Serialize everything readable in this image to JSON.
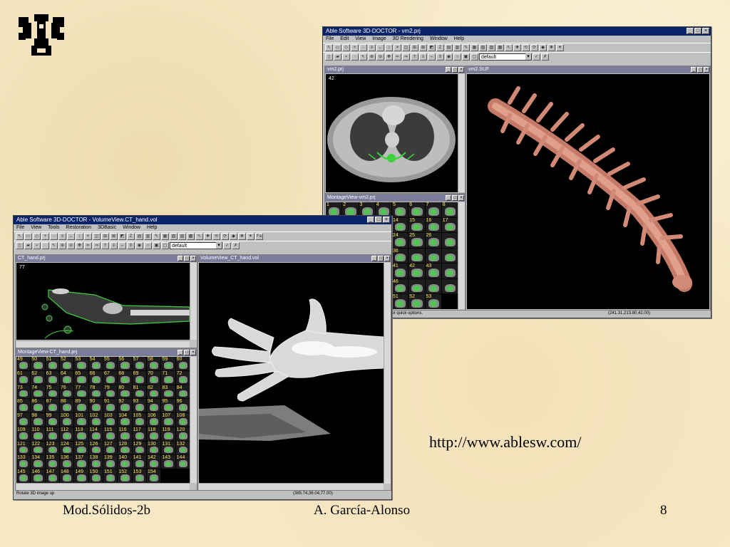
{
  "slide": {
    "url": "http://www.ablesw.com/",
    "footer_left": "Mod.Sólidos-2b",
    "footer_center": "A. García-Alonso",
    "page_number": "8"
  },
  "window_back": {
    "title": "Able Software 3D-DOCTOR - vm2.prj",
    "menu": [
      "File",
      "Edit",
      "View",
      "Image",
      "3D Rendering",
      "Window",
      "Help"
    ],
    "combo_value": "default",
    "child_slice": {
      "title": "vm2.prj",
      "slice_number": "42"
    },
    "child_montage": {
      "title": "MontageView-vm2.prj",
      "numbers": [
        "1",
        "2",
        "3",
        "4",
        "5",
        "6",
        "7",
        "8",
        "",
        "",
        "",
        "",
        "14",
        "15",
        "16",
        "17",
        "",
        "",
        "",
        "",
        "24",
        "25",
        "26",
        "",
        "",
        "",
        "",
        "",
        "36",
        "",
        "",
        "",
        "",
        "",
        "",
        "",
        "41",
        "42",
        "43",
        "",
        "",
        "",
        "",
        "",
        "46",
        "",
        "",
        "",
        "",
        "",
        "",
        "",
        "51",
        "52",
        "53"
      ]
    },
    "child_surface": {
      "title": "vm2.SUF"
    },
    "status_left": "s for quick options.",
    "status_right": "(241.31,213.80,42.00)"
  },
  "window_front": {
    "title": "Able Software 3D-DOCTOR - VolumeView.CT_hand.vol",
    "menu": [
      "File",
      "View",
      "Tools",
      "Restoration",
      "3DBasic",
      "Window",
      "Help"
    ],
    "combo_value": "default",
    "child_slice": {
      "title": "CT_hand.prj",
      "slice_number": "77"
    },
    "child_montage": {
      "title": "MontageView-CT_hand.prj",
      "numbers": [
        "49",
        "50",
        "51",
        "52",
        "53",
        "54",
        "55",
        "56",
        "57",
        "58",
        "59",
        "60",
        "61",
        "62",
        "63",
        "64",
        "65",
        "66",
        "67",
        "68",
        "69",
        "70",
        "71",
        "72",
        "73",
        "74",
        "75",
        "76",
        "77",
        "78",
        "79",
        "80",
        "81",
        "82",
        "83",
        "84",
        "85",
        "86",
        "87",
        "88",
        "89",
        "90",
        "91",
        "92",
        "93",
        "94",
        "95",
        "96",
        "97",
        "98",
        "99",
        "100",
        "101",
        "102",
        "103",
        "104",
        "105",
        "106",
        "107",
        "108",
        "109",
        "110",
        "111",
        "112",
        "113",
        "114",
        "115",
        "116",
        "117",
        "118",
        "119",
        "120",
        "121",
        "122",
        "123",
        "124",
        "125",
        "126",
        "127",
        "128",
        "129",
        "130",
        "131",
        "132",
        "133",
        "134",
        "135",
        "136",
        "137",
        "138",
        "139",
        "140",
        "141",
        "142",
        "143",
        "144",
        "145",
        "146",
        "147",
        "148",
        "149",
        "150",
        "151",
        "152",
        "153",
        "154"
      ]
    },
    "child_volume": {
      "title": "VolumeView_CT_hand.vol"
    },
    "status_left": "Rotate 3D image up",
    "status_right": "(385.74,36.04,77.00)"
  }
}
